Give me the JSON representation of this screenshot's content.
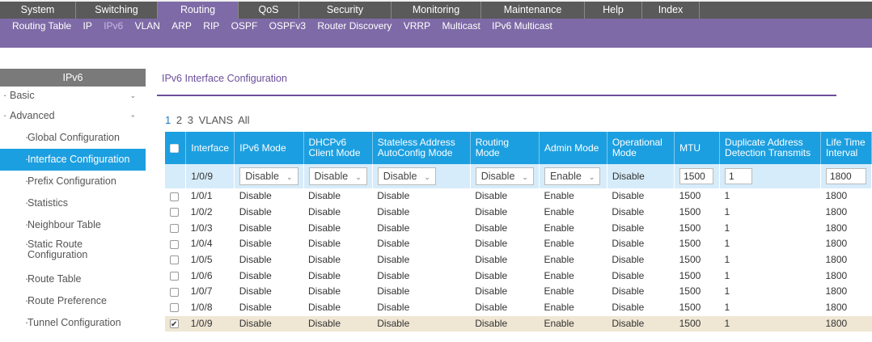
{
  "topnav": {
    "tabs": [
      {
        "label": "System",
        "w": 0
      },
      {
        "label": "Switching"
      },
      {
        "label": "Routing",
        "active": true
      },
      {
        "label": "QoS"
      },
      {
        "label": "Security"
      },
      {
        "label": "Monitoring"
      },
      {
        "label": "Maintenance"
      },
      {
        "label": "Help"
      },
      {
        "label": "Index"
      }
    ]
  },
  "subnav": {
    "items": [
      "Routing Table",
      "IP",
      "IPv6",
      "VLAN",
      "ARP",
      "RIP",
      "OSPF",
      "OSPFv3",
      "Router Discovery",
      "VRRP",
      "Multicast",
      "IPv6 Multicast"
    ],
    "active": "IPv6"
  },
  "sidebar": {
    "header": "IPv6",
    "basic": "Basic",
    "advanced": "Advanced",
    "items": [
      "Global Configuration",
      "Interface Configuration",
      "Prefix Configuration",
      "Statistics",
      "Neighbour Table",
      "Static Route Configuration",
      "Route Table",
      "Route Preference",
      "Tunnel Configuration"
    ],
    "active": "Interface Configuration"
  },
  "page": {
    "title": "IPv6 Interface Configuration",
    "pager": [
      "1",
      "2",
      "3",
      "VLANS",
      "All"
    ]
  },
  "table": {
    "headers": [
      "Interface",
      "IPv6 Mode",
      "DHCPv6 Client Mode",
      "Stateless Address AutoConfig Mode",
      "Routing Mode",
      "Admin Mode",
      "Operational Mode",
      "MTU",
      "Duplicate Address Detection Transmits",
      "Life Time Interval"
    ],
    "edit_row": {
      "interface": "1/0/9",
      "ipv6_mode": "Disable",
      "dhcpv6_client_mode": "Disable",
      "stateless_autoconfig": "Disable",
      "routing_mode": "Disable",
      "admin_mode": "Enable",
      "operational_mode": "Disable",
      "mtu": "1500",
      "dad_transmits": "1",
      "lifetime": "1800"
    },
    "rows": [
      {
        "interface": "1/0/1",
        "ipv6": "Disable",
        "dhcp": "Disable",
        "stateless": "Disable",
        "routing": "Disable",
        "admin": "Enable",
        "oper": "Disable",
        "mtu": "1500",
        "dad": "1",
        "life": "1800",
        "checked": false
      },
      {
        "interface": "1/0/2",
        "ipv6": "Disable",
        "dhcp": "Disable",
        "stateless": "Disable",
        "routing": "Disable",
        "admin": "Enable",
        "oper": "Disable",
        "mtu": "1500",
        "dad": "1",
        "life": "1800",
        "checked": false
      },
      {
        "interface": "1/0/3",
        "ipv6": "Disable",
        "dhcp": "Disable",
        "stateless": "Disable",
        "routing": "Disable",
        "admin": "Enable",
        "oper": "Disable",
        "mtu": "1500",
        "dad": "1",
        "life": "1800",
        "checked": false
      },
      {
        "interface": "1/0/4",
        "ipv6": "Disable",
        "dhcp": "Disable",
        "stateless": "Disable",
        "routing": "Disable",
        "admin": "Enable",
        "oper": "Disable",
        "mtu": "1500",
        "dad": "1",
        "life": "1800",
        "checked": false
      },
      {
        "interface": "1/0/5",
        "ipv6": "Disable",
        "dhcp": "Disable",
        "stateless": "Disable",
        "routing": "Disable",
        "admin": "Enable",
        "oper": "Disable",
        "mtu": "1500",
        "dad": "1",
        "life": "1800",
        "checked": false
      },
      {
        "interface": "1/0/6",
        "ipv6": "Disable",
        "dhcp": "Disable",
        "stateless": "Disable",
        "routing": "Disable",
        "admin": "Enable",
        "oper": "Disable",
        "mtu": "1500",
        "dad": "1",
        "life": "1800",
        "checked": false
      },
      {
        "interface": "1/0/7",
        "ipv6": "Disable",
        "dhcp": "Disable",
        "stateless": "Disable",
        "routing": "Disable",
        "admin": "Enable",
        "oper": "Disable",
        "mtu": "1500",
        "dad": "1",
        "life": "1800",
        "checked": false
      },
      {
        "interface": "1/0/8",
        "ipv6": "Disable",
        "dhcp": "Disable",
        "stateless": "Disable",
        "routing": "Disable",
        "admin": "Enable",
        "oper": "Disable",
        "mtu": "1500",
        "dad": "1",
        "life": "1800",
        "checked": false
      },
      {
        "interface": "1/0/9",
        "ipv6": "Disable",
        "dhcp": "Disable",
        "stateless": "Disable",
        "routing": "Disable",
        "admin": "Enable",
        "oper": "Disable",
        "mtu": "1500",
        "dad": "1",
        "life": "1800",
        "checked": true
      }
    ]
  },
  "colors": {
    "accent_purple": "#7e6aa6",
    "table_blue": "#1c9fe0",
    "nav_gray": "#5a5a5a"
  }
}
